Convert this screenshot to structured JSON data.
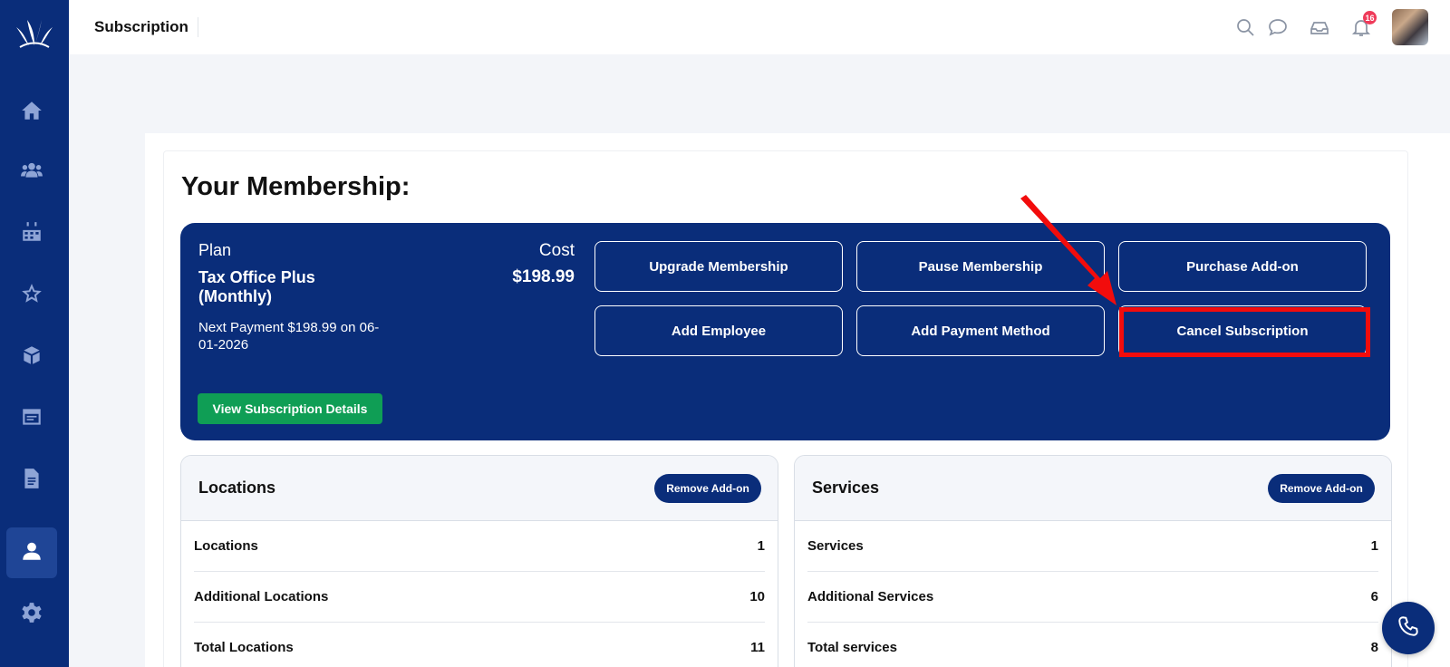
{
  "app": {
    "page_title": "Subscription"
  },
  "header": {
    "notification_count": "16"
  },
  "sidebar": {
    "items": [
      {
        "icon": "home-icon"
      },
      {
        "icon": "users-icon"
      },
      {
        "icon": "calendar-icon"
      },
      {
        "icon": "star-icon"
      },
      {
        "icon": "box-icon"
      },
      {
        "icon": "browser-icon"
      },
      {
        "icon": "document-icon"
      },
      {
        "icon": "user-icon",
        "active": true
      },
      {
        "icon": "gear-icon"
      }
    ]
  },
  "membership": {
    "heading": "Your Membership:",
    "plan_label": "Plan",
    "plan_name": "Tax Office Plus (Monthly)",
    "next_payment": "Next Payment $198.99 on 06-01-2026",
    "cost_label": "Cost",
    "cost_value": "$198.99",
    "buttons": {
      "upgrade": "Upgrade Membership",
      "pause": "Pause Membership",
      "purchase_addon": "Purchase Add-on",
      "add_employee": "Add Employee",
      "add_payment": "Add Payment Method",
      "cancel": "Cancel Subscription"
    },
    "view_details": "View Subscription Details"
  },
  "locations": {
    "title": "Locations",
    "remove_label": "Remove Add-on",
    "rows": [
      {
        "label": "Locations",
        "value": "1"
      },
      {
        "label": "Additional Locations",
        "value": "10"
      },
      {
        "label": "Total Locations",
        "value": "11"
      }
    ]
  },
  "services": {
    "title": "Services",
    "remove_label": "Remove Add-on",
    "rows": [
      {
        "label": "Services",
        "value": "1"
      },
      {
        "label": "Additional Services",
        "value": "6"
      },
      {
        "label": "Total services",
        "value": "8"
      }
    ]
  },
  "colors": {
    "brand": "#0a2d7a",
    "success": "#0f9e55",
    "annotation": "#f20c0c"
  }
}
